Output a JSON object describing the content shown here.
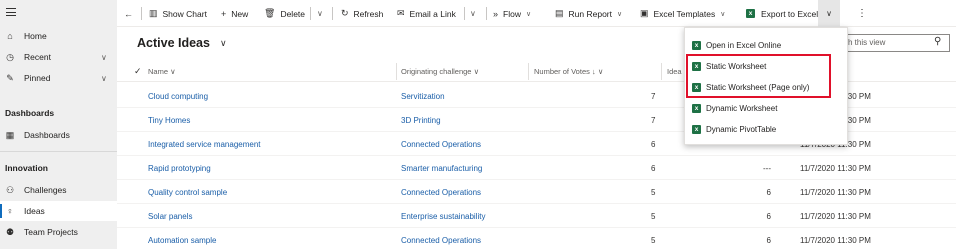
{
  "sidebar": {
    "items": [
      {
        "label": "Home",
        "icon": "home-icon"
      },
      {
        "label": "Recent",
        "icon": "clock-icon"
      },
      {
        "label": "Pinned",
        "icon": "pin-icon"
      }
    ],
    "sections": [
      {
        "title": "Dashboards",
        "items": [
          {
            "label": "Dashboards",
            "icon": "dashboard-icon"
          }
        ]
      },
      {
        "title": "Innovation",
        "items": [
          {
            "label": "Challenges",
            "icon": "challenges-icon"
          },
          {
            "label": "Ideas",
            "icon": "idea-icon"
          },
          {
            "label": "Team Projects",
            "icon": "team-icon"
          }
        ]
      }
    ]
  },
  "toolbar": {
    "show_chart": "Show Chart",
    "new": "New",
    "delete": "Delete",
    "refresh": "Refresh",
    "email_link": "Email a Link",
    "flow": "Flow",
    "run_report": "Run Report",
    "excel_templates": "Excel Templates",
    "export_excel": "Export to Excel"
  },
  "view": {
    "title": "Active Ideas",
    "search_placeholder": "ch this view"
  },
  "columns": {
    "name": "Name",
    "challenge": "Originating challenge",
    "votes": "Number of Votes",
    "score": "Idea S"
  },
  "rows": [
    {
      "name": "Cloud computing",
      "challenge": "Servitization",
      "votes": "7",
      "extra": "",
      "date": "11/7/2020 11:30 PM"
    },
    {
      "name": "Tiny Homes",
      "challenge": "3D Printing",
      "votes": "7",
      "extra": "",
      "date": "11/7/2020 11:30 PM"
    },
    {
      "name": "Integrated service management",
      "challenge": "Connected Operations",
      "votes": "6",
      "extra": "",
      "date": "11/7/2020 11:30 PM"
    },
    {
      "name": "Rapid prototyping",
      "challenge": "Smarter manufacturing",
      "votes": "6",
      "extra": "---",
      "date": "11/7/2020 11:30 PM"
    },
    {
      "name": "Quality control sample",
      "challenge": "Connected Operations",
      "votes": "5",
      "extra": "6",
      "date": "11/7/2020 11:30 PM"
    },
    {
      "name": "Solar panels",
      "challenge": "Enterprise sustainability",
      "votes": "5",
      "extra": "6",
      "date": "11/7/2020 11:30 PM"
    },
    {
      "name": "Automation sample",
      "challenge": "Connected Operations",
      "votes": "5",
      "extra": "6",
      "date": "11/7/2020 11:30 PM"
    }
  ],
  "export_menu": {
    "items": [
      "Open in Excel Online",
      "Static Worksheet",
      "Static Worksheet (Page only)",
      "Dynamic Worksheet",
      "Dynamic PivotTable"
    ]
  },
  "colors": {
    "accent": "#0f6cbd",
    "link": "#1a5ea8",
    "excel": "#1e7145",
    "highlight": "#e0102a"
  }
}
